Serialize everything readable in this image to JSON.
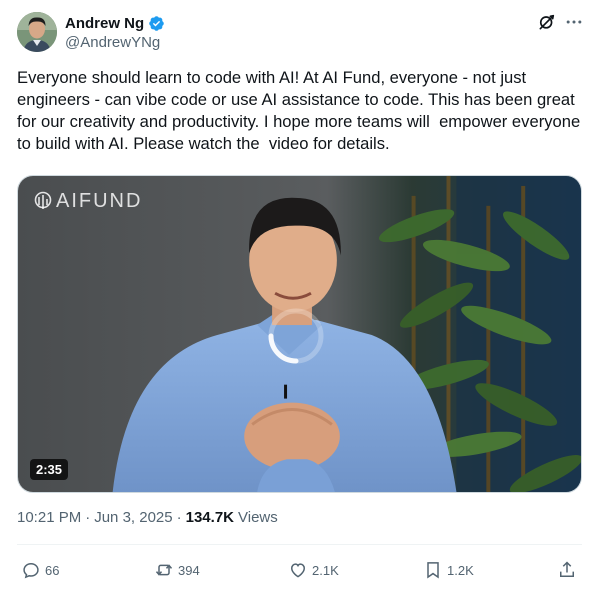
{
  "author": {
    "display_name": "Andrew Ng",
    "handle": "@AndrewYNg",
    "verified": true,
    "verified_color": "#1d9bf0"
  },
  "tweet": {
    "text": "Everyone should learn to code with AI! At AI Fund, everyone - not just engineers - can vibe code or use AI assistance to code. This has been great for our creativity and productivity. I hope more teams will  empower everyone to build with AI. Please watch the  video for details."
  },
  "media": {
    "watermark": "AIFUND",
    "duration": "2:35"
  },
  "meta": {
    "time": "10:21 PM",
    "separator1": "·",
    "date": "Jun 3, 2025",
    "separator2": "·",
    "views_count": "134.7K",
    "views_label": "Views"
  },
  "actions": {
    "replies": "66",
    "reposts": "394",
    "likes": "2.1K",
    "bookmarks": "1.2K"
  },
  "icons": {
    "grok": "grok-icon",
    "more": "more-icon",
    "reply": "reply-icon",
    "repost": "repost-icon",
    "like": "heart-icon",
    "bookmark": "bookmark-icon",
    "share": "share-icon"
  },
  "colors": {
    "text": "#0f1419",
    "secondary": "#536471",
    "divider": "#eff3f4"
  }
}
